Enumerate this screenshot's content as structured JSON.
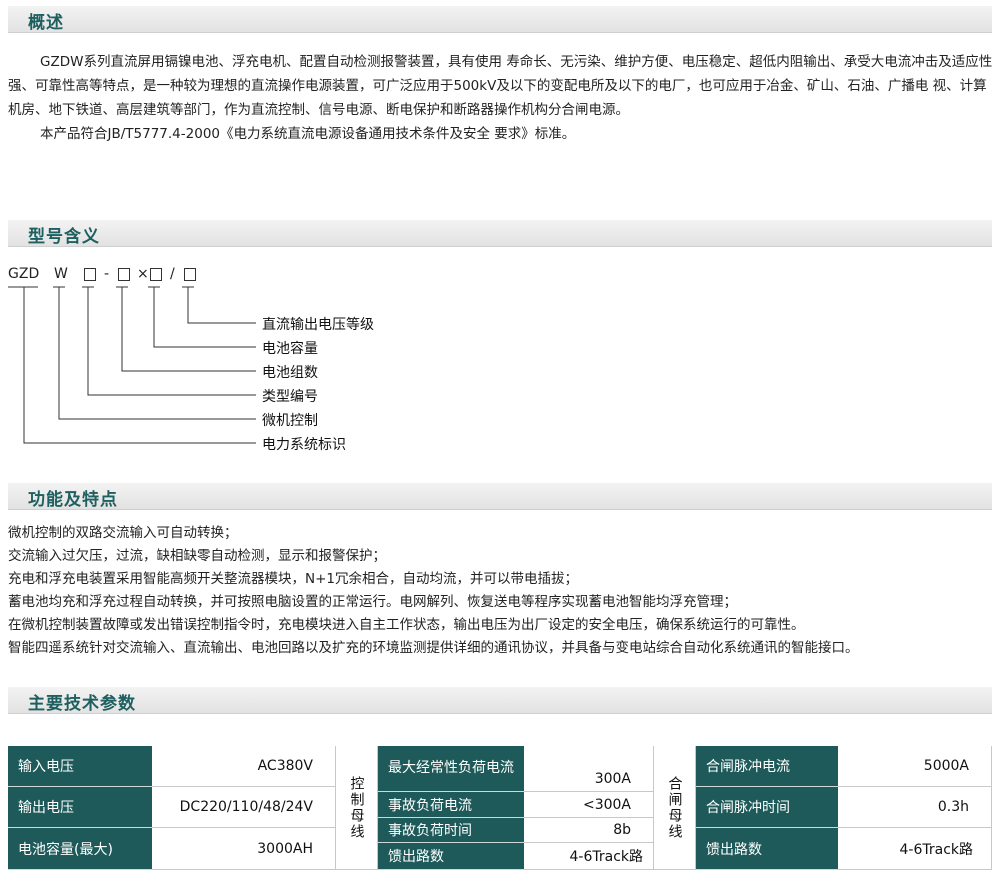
{
  "overview": {
    "title": "概述",
    "p1": "GZDW系列直流屏用镉镍电池、浮充电机、配置自动检测报警装置，具有使用 寿命长、无污染、维护方便、电压稳定、超低内阻输出、承受大电流冲击及适应性强、可靠性高等特点，是一种较为理想的直流操作电源装置，可广泛应用于500kV及以下的变配电所及以下的电厂，也可应用于冶金、矿山、石油、广播电 视、计算机房、地下铁道、高层建筑等部门，作为直流控制、信号电源、断电保护和断路器操作机构分合闸电源。",
    "p2": "本产品符合JB/T5777.4-2000《电力系统直流电源设备通用技术条件及安全 要求》标准。"
  },
  "model": {
    "title": "型号含义",
    "code_prefix": "GZD",
    "code_w": "W",
    "sep_dash": "-",
    "sep_x": "×",
    "sep_slash": "/",
    "legend": [
      "直流输出电压等级",
      "电池容量",
      "电池组数",
      "类型编号",
      "微机控制",
      "电力系统标识"
    ]
  },
  "features": {
    "title": "功能及特点",
    "items": [
      "微机控制的双路交流输入可自动转换；",
      "交流输入过欠压，过流，缺相缺零自动检测，显示和报警保护；",
      "充电和浮充电装置采用智能高频开关整流器模块，N+1冗余相合，自动均流，并可以带电插拔；",
      "蓄电池均充和浮充过程自动转换，并可按照电脑设置的正常运行。电网解列、恢复送电等程序实现蓄电池智能均浮充管理；",
      "在微机控制装置故障或发出错误控制指令时，充电模块进入自主工作状态，输出电压为出厂设定的安全电压，确保系统运行的可靠性。",
      "智能四遥系统针对交流输入、直流输出、电池回路以及扩充的环境监测提供详细的通讯协议，并具备与变电站综合自动化系统通讯的智能接口。"
    ]
  },
  "specs": {
    "title": "主要技术参数",
    "col1": [
      {
        "label": "输入电压",
        "value": "AC380V"
      },
      {
        "label": "输出电压",
        "value": "DC220/110/48/24V"
      },
      {
        "label": "电池容量(最大)",
        "value": "3000AH"
      }
    ],
    "group2": "控制母线",
    "col2": [
      {
        "label": "最大经常性负荷电流",
        "value": "300A"
      },
      {
        "label": "事故负荷电流",
        "value": "<300A"
      },
      {
        "label": "事故负荷时间",
        "value": "8b"
      },
      {
        "label": "馈出路数",
        "value": "4-6Track路"
      }
    ],
    "group3": "合闸母线",
    "col3": [
      {
        "label": "合闸脉冲电流",
        "value": "5000A"
      },
      {
        "label": "合闸脉冲时间",
        "value": "0.3h"
      },
      {
        "label": "馈出路数",
        "value": "4-6Track路"
      }
    ]
  }
}
